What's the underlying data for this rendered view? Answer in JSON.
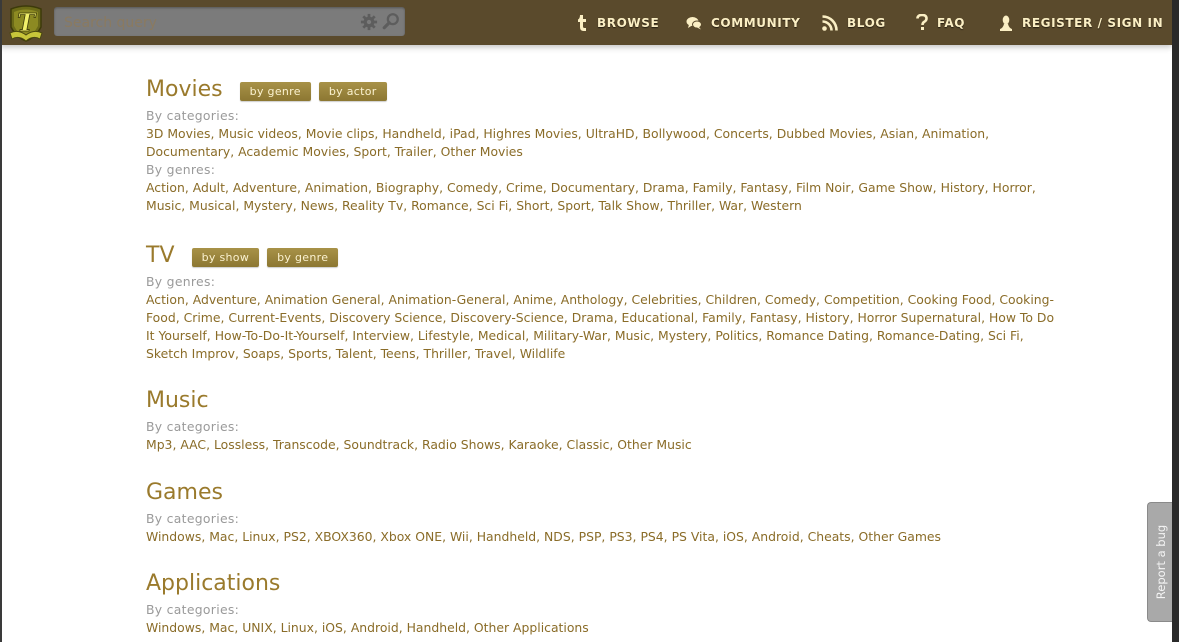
{
  "header": {
    "logo_letter": "T",
    "search": {
      "placeholder": "Search query",
      "value": ""
    },
    "nav": [
      {
        "label": "BROWSE",
        "icon": "tumblr-t-icon"
      },
      {
        "label": "COMMUNITY",
        "icon": "chat-bubbles-icon"
      },
      {
        "label": "BLOG",
        "icon": "rss-icon"
      },
      {
        "label": "FAQ",
        "icon": "question-mark-icon"
      },
      {
        "label": "REGISTER / SIGN IN",
        "icon": "user-icon"
      }
    ]
  },
  "colors": {
    "header_bg": "#5a4a2c",
    "accent_title": "#9a7a2c",
    "link": "#8a6c28",
    "pill_bg": "#9c8640",
    "nav_text": "#fbefc4"
  },
  "sections": {
    "movies": {
      "title": "Movies",
      "buttons": [
        "by genre",
        "by actor"
      ],
      "groups": [
        {
          "label": "By categories:",
          "items": [
            "3D Movies",
            "Music videos",
            "Movie clips",
            "Handheld",
            "iPad",
            "Highres Movies",
            "UltraHD",
            "Bollywood",
            "Concerts",
            "Dubbed Movies",
            "Asian",
            "Animation",
            "Documentary",
            "Academic Movies",
            "Sport",
            "Trailer",
            "Other Movies"
          ]
        },
        {
          "label": "By genres:",
          "items": [
            "Action",
            "Adult",
            "Adventure",
            "Animation",
            "Biography",
            "Comedy",
            "Crime",
            "Documentary",
            "Drama",
            "Family",
            "Fantasy",
            "Film Noir",
            "Game Show",
            "History",
            "Horror",
            "Music",
            "Musical",
            "Mystery",
            "News",
            "Reality Tv",
            "Romance",
            "Sci Fi",
            "Short",
            "Sport",
            "Talk Show",
            "Thriller",
            "War",
            "Western"
          ]
        }
      ]
    },
    "tv": {
      "title": "TV",
      "buttons": [
        "by show",
        "by genre"
      ],
      "groups": [
        {
          "label": "By genres:",
          "items": [
            "Action",
            "Adventure",
            "Animation General",
            "Animation-General",
            "Anime",
            "Anthology",
            "Celebrities",
            "Children",
            "Comedy",
            "Competition",
            "Cooking Food",
            "Cooking-Food",
            "Crime",
            "Current-Events",
            "Discovery Science",
            "Discovery-Science",
            "Drama",
            "Educational",
            "Family",
            "Fantasy",
            "History",
            "Horror Supernatural",
            "How To Do It Yourself",
            "How-To-Do-It-Yourself",
            "Interview",
            "Lifestyle",
            "Medical",
            "Military-War",
            "Music",
            "Mystery",
            "Politics",
            "Romance Dating",
            "Romance-Dating",
            "Sci Fi",
            "Sketch Improv",
            "Soaps",
            "Sports",
            "Talent",
            "Teens",
            "Thriller",
            "Travel",
            "Wildlife"
          ]
        }
      ]
    },
    "music": {
      "title": "Music",
      "buttons": [],
      "groups": [
        {
          "label": "By categories:",
          "items": [
            "Mp3",
            "AAC",
            "Lossless",
            "Transcode",
            "Soundtrack",
            "Radio Shows",
            "Karaoke",
            "Classic",
            "Other Music"
          ]
        }
      ]
    },
    "games": {
      "title": "Games",
      "buttons": [],
      "groups": [
        {
          "label": "By categories:",
          "items": [
            "Windows",
            "Mac",
            "Linux",
            "PS2",
            "XBOX360",
            "Xbox ONE",
            "Wii",
            "Handheld",
            "NDS",
            "PSP",
            "PS3",
            "PS4",
            "PS Vita",
            "iOS",
            "Android",
            "Cheats",
            "Other Games"
          ]
        }
      ]
    },
    "applications": {
      "title": "Applications",
      "buttons": [],
      "groups": [
        {
          "label": "By categories:",
          "items": [
            "Windows",
            "Mac",
            "UNIX",
            "Linux",
            "iOS",
            "Android",
            "Handheld",
            "Other Applications"
          ]
        }
      ]
    }
  },
  "report_bug": {
    "label": "Report a bug"
  }
}
